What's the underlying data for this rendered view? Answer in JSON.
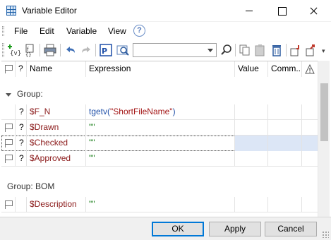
{
  "window": {
    "title": "Variable Editor"
  },
  "menu": {
    "items": [
      "File",
      "Edit",
      "Variable",
      "View"
    ],
    "help_icon": "help-question-icon"
  },
  "toolbar": {
    "icons": [
      "new-variable-icon",
      "new-function-icon",
      "print-icon",
      "undo-icon",
      "redo-icon",
      "properties-editor-icon",
      "find-in-page-icon",
      "search-icon",
      "copy-icon",
      "paste-icon",
      "delete-icon",
      "import-icon",
      "export-icon"
    ],
    "search_value": ""
  },
  "grid": {
    "columns": [
      {
        "key": "flag",
        "label": ""
      },
      {
        "key": "q",
        "label": "?"
      },
      {
        "key": "name",
        "label": "Name"
      },
      {
        "key": "expression",
        "label": "Expression"
      },
      {
        "key": "value",
        "label": "Value"
      },
      {
        "key": "comment",
        "label": "Comm..."
      },
      {
        "key": "warn",
        "label": ""
      }
    ],
    "groups": [
      {
        "label": "Group:",
        "rows": [
          {
            "flag": false,
            "q": "?",
            "name": "$F_N",
            "expression_fn": "tgetv(",
            "expression_str": "\"ShortFileName\"",
            "expression_close": ")",
            "value": "",
            "comment": ""
          },
          {
            "flag": true,
            "q": "?",
            "name": "$Drawn",
            "expression": "\"\"",
            "value": "",
            "comment": ""
          },
          {
            "flag": true,
            "q": "?",
            "name": "$Checked",
            "expression": "\"\"",
            "value": "",
            "comment": "",
            "selected": true
          },
          {
            "flag": true,
            "q": "?",
            "name": "$Approved",
            "expression": "\"\"",
            "value": "",
            "comment": ""
          }
        ]
      },
      {
        "label": "Group: BOM",
        "rows": [
          {
            "flag": true,
            "q": "",
            "name": "$Description",
            "expression": "\"\"",
            "value": "",
            "comment": ""
          }
        ]
      }
    ]
  },
  "buttons": {
    "ok": "OK",
    "apply": "Apply",
    "cancel": "Cancel"
  },
  "colors": {
    "name_text": "#8b1a1a",
    "expression_text": "#1a7f1a",
    "function_text": "#1f4fa8",
    "selection": "#dce6f6",
    "default_button_border": "#0078d7"
  }
}
